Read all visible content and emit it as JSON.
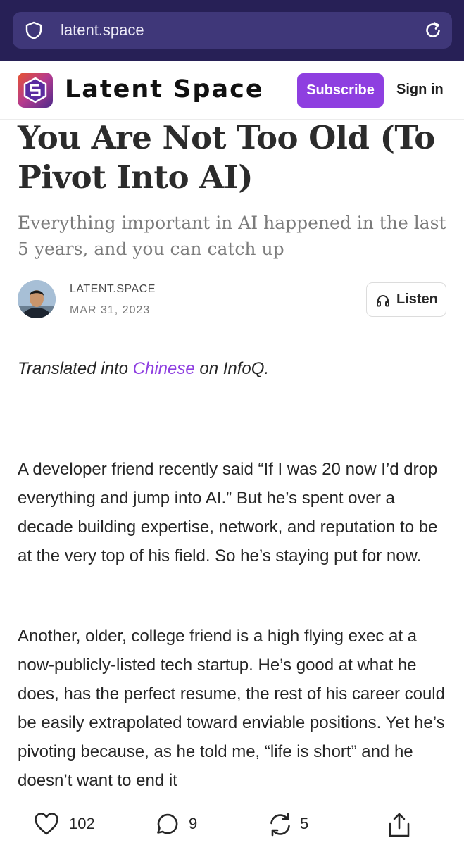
{
  "browser": {
    "url": "latent.space",
    "icons": [
      "shield-icon",
      "reload-icon"
    ]
  },
  "header": {
    "site_name": "Latent Space",
    "subscribe_label": "Subscribe",
    "signin_label": "Sign in",
    "accent_color": "#8e3fe0"
  },
  "article": {
    "title": "You Are Not Too Old (To Pivot Into AI)",
    "subtitle": "Everything important in AI happened in the last 5 years, and you can catch up",
    "author": "LATENT.SPACE",
    "date": "MAR 31, 2023",
    "listen_label": "Listen",
    "translation": {
      "prefix": "Translated into ",
      "link_text": "Chinese",
      "suffix": " on InfoQ."
    },
    "paragraphs": [
      "A developer friend recently said “If I was 20 now I’d drop everything and jump into AI.” But he’s spent over a decade building expertise, network, and reputation to be at the very top of his field. So he’s staying put for now.",
      "Another, older, college friend is a high flying exec at a now-publicly-listed tech startup. He’s good at what he does, has the perfect resume, the rest of his career could be easily extrapolated toward enviable positions. Yet he’s pivoting because, as he told me, “life is short” and he doesn’t want to end it"
    ]
  },
  "actions": {
    "likes": "102",
    "comments": "9",
    "restacks": "5",
    "icons": [
      "heart-icon",
      "comment-icon",
      "restack-icon",
      "share-icon"
    ]
  }
}
